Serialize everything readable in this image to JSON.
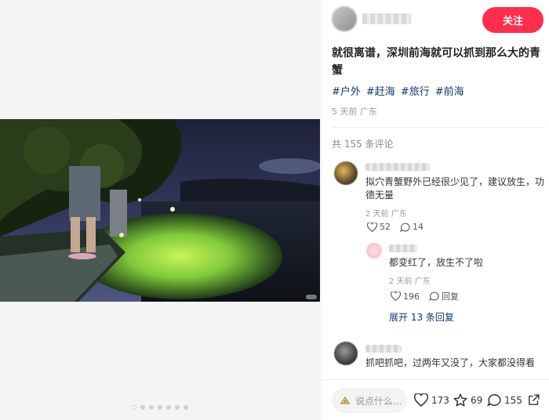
{
  "author": {
    "follow_label": "关注"
  },
  "post": {
    "title": "就很离谱，深圳前海就可以抓到那么大的青蟹",
    "tags": [
      "#户外",
      "#赶海",
      "#旅行",
      "#前海"
    ],
    "meta": "5 天前 广东",
    "comment_count": "共 155 条评论"
  },
  "comments": [
    {
      "text": "拟穴青蟹野外已经很少见了，建议放生，功德无量",
      "meta": "2 天前 广东",
      "likes": "52",
      "replies": "14"
    },
    {
      "text": "都变红了，放生不了啦",
      "meta": "2 天前 广东",
      "likes": "196",
      "reply_label": "回复"
    },
    {
      "text": "抓吧抓吧，过两年又没了，大家都没得看"
    }
  ],
  "expand_label": "展开 13 条回复",
  "bottom_bar": {
    "input_placeholder": "说点什么...",
    "likes": "173",
    "favorites": "69",
    "comments": "155"
  },
  "carousel": {
    "count": 7,
    "active_index": 0
  },
  "colors": {
    "accent": "#ff2e4d",
    "tag": "#13386c"
  },
  "icons": [
    "heart-icon",
    "chat-bubble-icon",
    "star-icon",
    "share-icon",
    "emoji-icon"
  ]
}
